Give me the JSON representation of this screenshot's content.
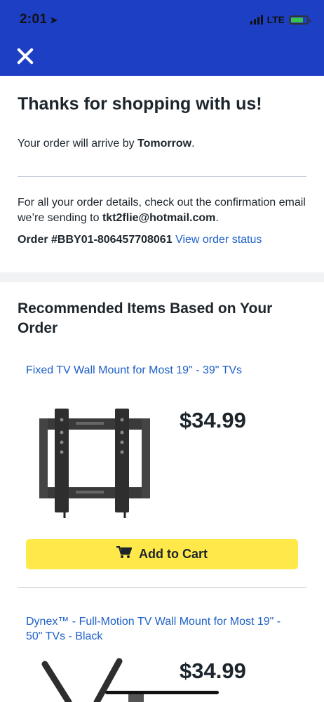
{
  "status_bar": {
    "time": "2:01",
    "network": "LTE"
  },
  "header": {
    "close_icon": "close-icon"
  },
  "confirmation": {
    "title": "Thanks for shopping with us!",
    "arrive_prefix": "Your order will arrive by ",
    "arrive_when": "Tomorrow",
    "arrive_suffix": ".",
    "details_text": "For all your order details, check out the confirmation email we’re sending to ",
    "email": "tkt2flie@hotmail.com",
    "details_suffix": ".",
    "order_label": "Order #BBY01-806457708061",
    "order_link": "View order status"
  },
  "recommended": {
    "heading": "Recommended Items Based on Your Order",
    "items": [
      {
        "title": "Fixed TV Wall Mount for Most 19\" - 39\" TVs",
        "price": "$34.99",
        "button": "Add to Cart"
      },
      {
        "title": "Dynex™ - Full-Motion TV Wall Mount for Most 19\" - 50\" TVs - Black",
        "price": "$34.99"
      }
    ]
  },
  "colors": {
    "header_bg": "#1d3fc4",
    "link": "#1d5fc7",
    "cart_button": "#ffe84a"
  }
}
